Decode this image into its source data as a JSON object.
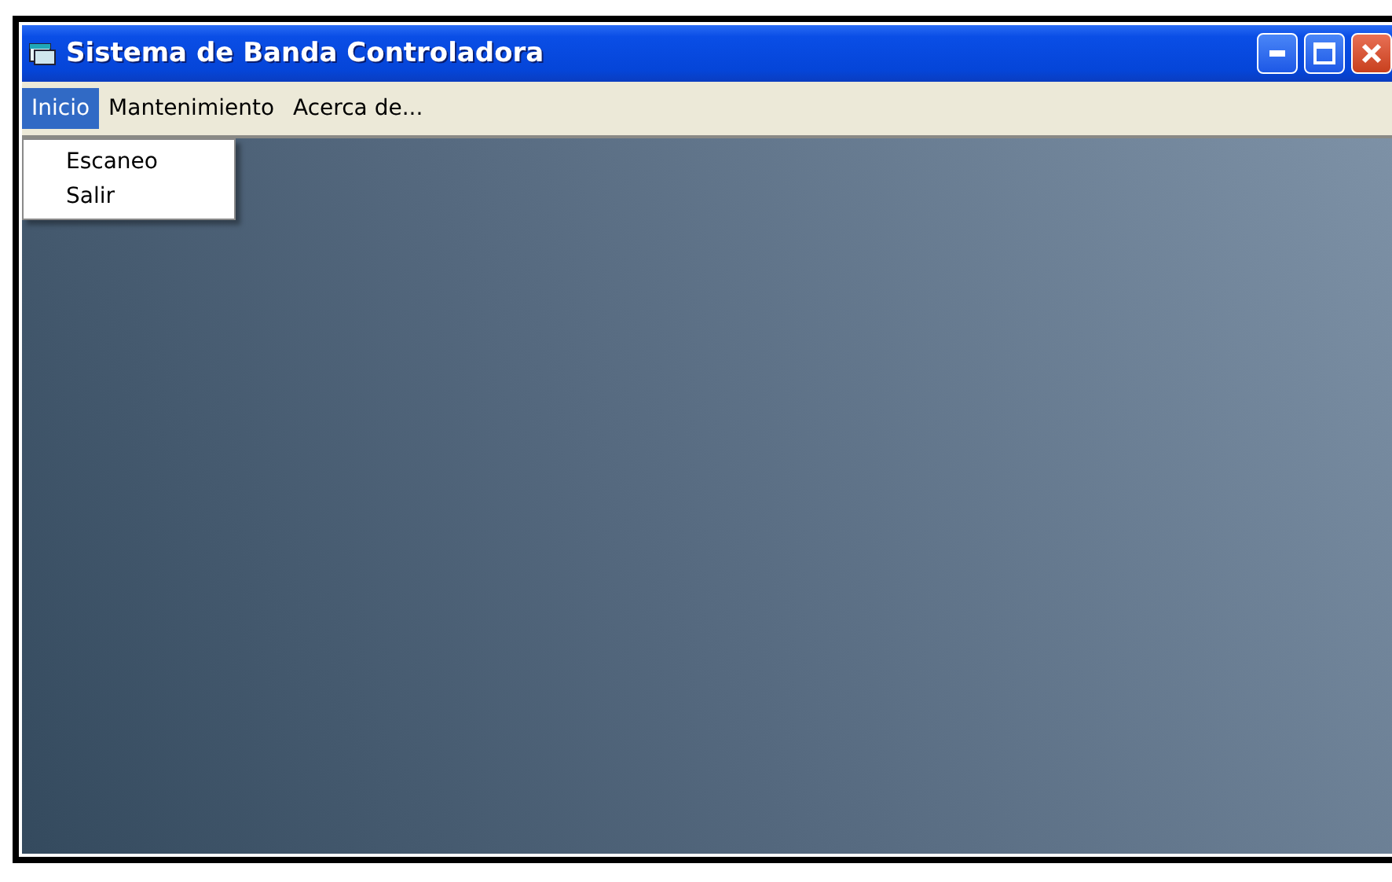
{
  "window": {
    "title": "Sistema de Banda Controladora"
  },
  "menu": [
    {
      "label": "Inicio",
      "selected": true
    },
    {
      "label": "Mantenimiento",
      "selected": false
    },
    {
      "label": "Acerca de...",
      "selected": false
    }
  ],
  "dropdown": {
    "items": [
      {
        "label": "Escaneo"
      },
      {
        "label": "Salir"
      }
    ]
  }
}
